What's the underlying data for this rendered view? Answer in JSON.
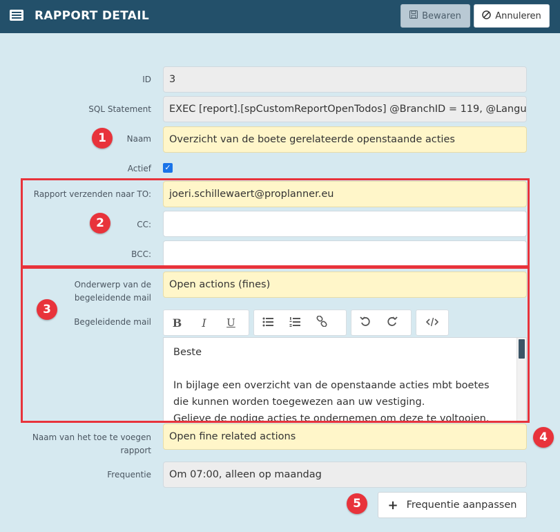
{
  "header": {
    "title": "RAPPORT DETAIL",
    "save_label": "Bewaren",
    "cancel_label": "Annuleren"
  },
  "form": {
    "id": {
      "label": "ID",
      "value": "3"
    },
    "sql": {
      "label": "SQL Statement",
      "value": "EXEC [report].[spCustomReportOpenTodos] @BranchID = 119, @Langu"
    },
    "naam": {
      "label": "Naam",
      "value": "Overzicht van de boete gerelateerde openstaande acties"
    },
    "actief": {
      "label": "Actief",
      "checked": true
    },
    "to": {
      "label": "Rapport verzenden naar TO:",
      "value": "joeri.schillewaert@proplanner.eu"
    },
    "cc": {
      "label": "CC:",
      "value": ""
    },
    "bcc": {
      "label": "BCC:",
      "value": ""
    },
    "onderwerp": {
      "label_line1": "Onderwerp van de",
      "label_line2": "begeleidende mail",
      "value": "Open actions (fines)"
    },
    "mail": {
      "label": "Begeleidende mail",
      "paragraph1": "Beste",
      "paragraph2_line1": "In bijlage een overzicht van de openstaande acties mbt boetes",
      "paragraph2_line2": "die kunnen worden toegewezen aan uw vestiging.",
      "paragraph2_line3": "Gelieve de nodige acties te ondernemen om deze te voltooien."
    },
    "rapportnaam": {
      "label_line1": "Naam van het toe te voegen",
      "label_line2": "rapport",
      "value": "Open fine related actions"
    },
    "frequentie": {
      "label": "Frequentie",
      "value": "Om 07:00, alleen op maandag"
    },
    "freq_button_label": "Frequentie aanpassen"
  },
  "toolbar": {
    "bold": "B",
    "italic": "I",
    "underline": "U"
  },
  "badges": [
    "1",
    "2",
    "3",
    "4",
    "5"
  ],
  "colors": {
    "header_bg": "#23506a",
    "page_bg": "#d6e9f0",
    "required_field_bg": "#fff6c9",
    "readonly_field_bg": "#ededed",
    "annotation_red": "#e8333b",
    "checkbox_blue": "#1a73e8"
  },
  "icons": {
    "header": "list-icon",
    "save": "floppy-disk-icon",
    "cancel": "ban-icon",
    "bullet_list": "bullet-list-icon",
    "numbered_list": "numbered-list-icon",
    "link": "link-icon",
    "undo": "undo-icon",
    "redo": "redo-icon",
    "code": "code-icon",
    "add": "plus-icon"
  }
}
